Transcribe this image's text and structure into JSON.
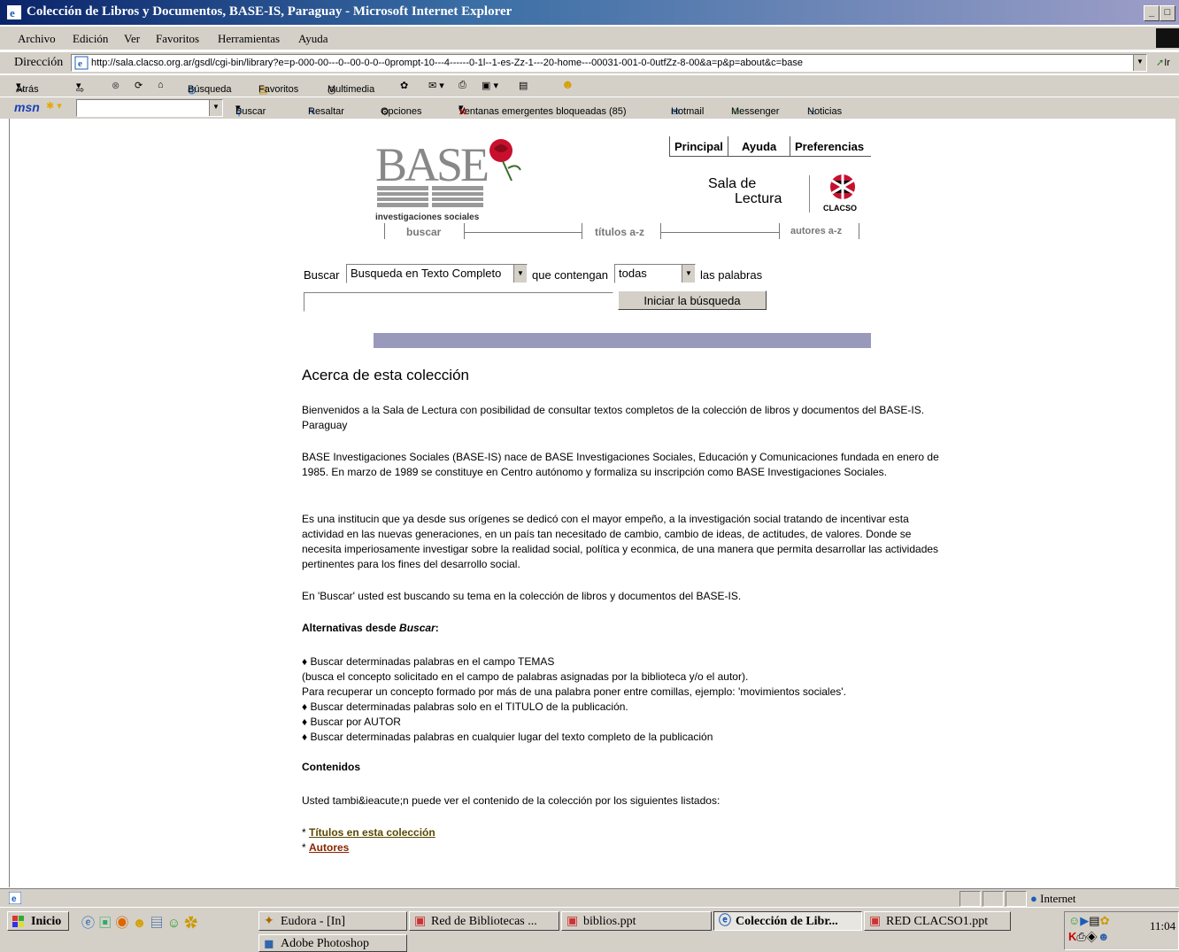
{
  "window": {
    "title": "Colección de Libros y Documentos, BASE-IS, Paraguay - Microsoft Internet Explorer",
    "min": "_",
    "max": "□"
  },
  "menu": [
    "Archivo",
    "Edición",
    "Ver",
    "Favoritos",
    "Herramientas",
    "Ayuda"
  ],
  "address": {
    "label": "Dirección",
    "url": "http://sala.clacso.org.ar/gsdl/cgi-bin/library?e=p-000-00---0--00-0-0--0prompt-10---4------0-1l--1-es-Zz-1---20-home---00031-001-0-0utfZz-8-00&a=p&p=about&c=base",
    "go": "Ir"
  },
  "toolbar": {
    "back": "Atrás",
    "search": "Búsqueda",
    "favorites": "Favoritos",
    "media": "Multimedia"
  },
  "msnbar": {
    "logo": "msn",
    "search": "Buscar",
    "highlight": "Resaltar",
    "options": "Opciones",
    "popups": "Ventanas emergentes bloqueadas (85)",
    "hotmail": "Hotmail",
    "messenger": "Messenger",
    "news": "Noticias"
  },
  "page": {
    "logo": {
      "main": "BASE",
      "sub": "investigaciones sociales",
      "clacso": "CLACSO"
    },
    "nav_top": [
      "Principal",
      "Ayuda",
      "Preferencias"
    ],
    "sala": {
      "line1": "Sala de",
      "line2": "Lectura"
    },
    "nav_bottom": [
      "buscar",
      "títulos a-z",
      "autores a-z"
    ],
    "search": {
      "buscar": "Buscar",
      "type_value": "Busqueda en Texto Completo",
      "que_contengan": "que contengan",
      "mode_value": "todas",
      "las_palabras": "las palabras",
      "query_value": "",
      "button": "Iniciar la búsqueda"
    },
    "heading": "Acerca de esta colección",
    "p1": "Bienvenidos a la Sala de Lectura con posibilidad de consultar textos completos de la colección de libros y documentos del BASE-IS. Paraguay",
    "p2": "BASE Investigaciones Sociales (BASE-IS) nace de BASE Investigaciones Sociales, Educación y Comunicaciones fundada en enero de 1985. En marzo de 1989 se constituye en Centro autónomo y formaliza su inscripción como BASE Investigaciones Sociales.",
    "p3": "Es una institucin que ya desde sus orígenes se dedicó con el mayor empeño, a la investigación social tratando de incentivar esta actividad en las nuevas generaciones, en un país tan necesitado de cambio, cambio de ideas, de actitudes, de valores. Donde se necesita imperiosamente investigar sobre la realidad social, política y econmica, de una manera que permita desarrollar las actividades pertinentes para los fines del desarrollo social.",
    "p4": "En 'Buscar' usted est buscando su tema en la colección de libros y documentos del BASE-IS.",
    "alt_heading_prefix": "Alternativas desde ",
    "alt_heading_italic": "Buscar",
    "alt_heading_suffix": ":",
    "alt_lines": [
      "♦ Buscar determinadas palabras en el campo TEMAS",
      "(busca el concepto solicitado en el campo de palabras asignadas por la biblioteca y/o el autor).",
      "Para recuperar un concepto formado por más de una palabra poner entre comillas, ejemplo: 'movimientos sociales'.",
      "♦ Buscar determinadas palabras solo en el TITULO de la publicación.",
      "♦ Buscar por AUTOR",
      "♦ Buscar determinadas palabras en cualquier lugar del texto completo de la publicación"
    ],
    "contenidos": "Contenidos",
    "contenidos_text": "Usted tambi&ieacute;n puede ver el contenido de la colección por los siguientes listados:",
    "link_bullet": "*",
    "link1": "Títulos en esta colección",
    "link2": "Autores"
  },
  "status": {
    "zone": "Internet"
  },
  "taskbar": {
    "start": "Inicio",
    "buttons": [
      "Eudora - [In]",
      "Red de Bibliotecas ...",
      "biblios.ppt",
      "Colección de Libr...",
      "RED CLACSO1.ppt",
      "Adobe Photoshop"
    ],
    "clock": "11:04"
  },
  "colors": {
    "titlebar": "#0a246a",
    "link": "#8b2500",
    "bar": "#9999bb"
  }
}
